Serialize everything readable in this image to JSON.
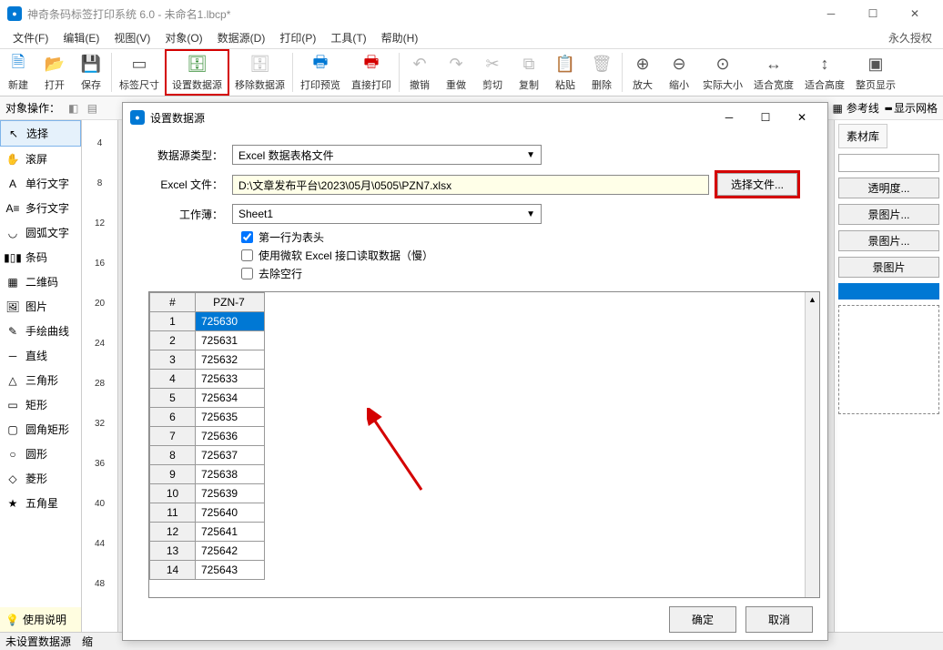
{
  "title": "神奇条码标签打印系统 6.0 - 未命名1.lbcp*",
  "menus": [
    "文件(F)",
    "编辑(E)",
    "视图(V)",
    "对象(O)",
    "数据源(D)",
    "打印(P)",
    "工具(T)",
    "帮助(H)"
  ],
  "license": "永久授权",
  "toolbar": [
    {
      "l": "新建",
      "c": "#0078d4"
    },
    {
      "l": "打开",
      "c": "#e8a33d"
    },
    {
      "l": "保存",
      "c": "#6b4fbb"
    },
    {
      "sep": true
    },
    {
      "l": "标签尺寸",
      "c": "#555"
    },
    {
      "l": "设置数据源",
      "c": "#3a8f3a",
      "hl": true
    },
    {
      "l": "移除数据源",
      "c": "#bbb"
    },
    {
      "sep": true
    },
    {
      "l": "打印预览",
      "c": "#0078d4"
    },
    {
      "l": "直接打印",
      "c": "#d40000"
    },
    {
      "sep": true
    },
    {
      "l": "撤销",
      "c": "#bbb"
    },
    {
      "l": "重做",
      "c": "#bbb"
    },
    {
      "l": "剪切",
      "c": "#bbb"
    },
    {
      "l": "复制",
      "c": "#bbb"
    },
    {
      "l": "粘贴",
      "c": "#bbb"
    },
    {
      "l": "删除",
      "c": "#bbb"
    },
    {
      "sep": true
    },
    {
      "l": "放大",
      "c": "#555"
    },
    {
      "l": "缩小",
      "c": "#555"
    },
    {
      "l": "实际大小",
      "c": "#555"
    },
    {
      "l": "适合宽度",
      "c": "#555"
    },
    {
      "l": "适合高度",
      "c": "#555"
    },
    {
      "l": "整页显示",
      "c": "#555"
    }
  ],
  "secondbar": {
    "label": "对象操作：",
    "ref": "参考线",
    "grid": "显示网格"
  },
  "tools": [
    {
      "l": "选择",
      "sel": true
    },
    {
      "l": "滚屏"
    },
    {
      "l": "单行文字"
    },
    {
      "l": "多行文字"
    },
    {
      "l": "圆弧文字"
    },
    {
      "l": "条码"
    },
    {
      "l": "二维码"
    },
    {
      "l": "图片"
    },
    {
      "l": "手绘曲线"
    },
    {
      "l": "直线"
    },
    {
      "l": "三角形"
    },
    {
      "l": "矩形"
    },
    {
      "l": "圆角矩形"
    },
    {
      "l": "圆形"
    },
    {
      "l": "菱形"
    },
    {
      "l": "五角星"
    }
  ],
  "tip": "使用说明",
  "ruler": [
    "4",
    "8",
    "12",
    "16",
    "20",
    "24",
    "28",
    "32",
    "36",
    "40",
    "44",
    "48"
  ],
  "right": {
    "tab": "素材库",
    "t": "透明度...",
    "b1": "景图片...",
    "b2": "景图片...",
    "b3": "景图片"
  },
  "status": {
    "ds": "未设置数据源",
    "scale": "缩"
  },
  "dlg": {
    "title": "设置数据源",
    "l_type": "数据源类型：",
    "v_type": "Excel 数据表格文件",
    "l_file": "Excel 文件：",
    "v_file": "D:\\文章发布平台\\2023\\05月\\0505\\PZN7.xlsx",
    "btn_file": "选择文件...",
    "l_sheet": "工作薄：",
    "v_sheet": "Sheet1",
    "chk1": "第一行为表头",
    "chk2": "使用微软 Excel 接口读取数据（慢）",
    "chk3": "去除空行",
    "col_idx": "#",
    "col_h": "PZN-7",
    "rows": [
      {
        "n": "1",
        "v": "725630",
        "sel": true
      },
      {
        "n": "2",
        "v": "725631"
      },
      {
        "n": "3",
        "v": "725632"
      },
      {
        "n": "4",
        "v": "725633"
      },
      {
        "n": "5",
        "v": "725634"
      },
      {
        "n": "6",
        "v": "725635"
      },
      {
        "n": "7",
        "v": "725636"
      },
      {
        "n": "8",
        "v": "725637"
      },
      {
        "n": "9",
        "v": "725638"
      },
      {
        "n": "10",
        "v": "725639"
      },
      {
        "n": "11",
        "v": "725640"
      },
      {
        "n": "12",
        "v": "725641"
      },
      {
        "n": "13",
        "v": "725642"
      },
      {
        "n": "14",
        "v": "725643"
      }
    ],
    "ok": "确定",
    "cancel": "取消"
  }
}
